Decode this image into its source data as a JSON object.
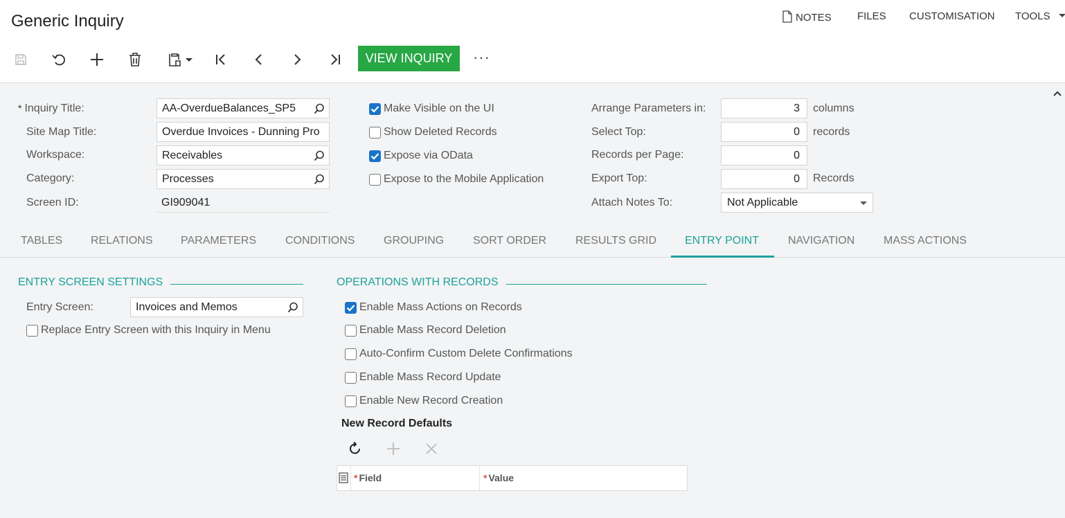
{
  "header": {
    "title": "Generic Inquiry",
    "links": [
      "NOTES",
      "FILES",
      "CUSTOMISATION",
      "TOOLS"
    ]
  },
  "toolbar": {
    "view_inquiry_label": "VIEW INQUIRY",
    "more_label": "···",
    "icons": [
      "save-icon",
      "undo-icon",
      "add-icon",
      "delete-icon",
      "clipboard-icon",
      "first-icon",
      "prev-icon",
      "next-icon",
      "last-icon"
    ]
  },
  "form": {
    "inquiry_title_label": "Inquiry Title:",
    "inquiry_title_value": "AA-OverdueBalances_SP5",
    "site_map_title_label": "Site Map Title:",
    "site_map_title_value": "Overdue Invoices - Dunning Pro",
    "workspace_label": "Workspace:",
    "workspace_value": "Receivables",
    "category_label": "Category:",
    "category_value": "Processes",
    "screen_id_label": "Screen ID:",
    "screen_id_value": "GI909041",
    "required_mark": "*",
    "checkboxes": [
      {
        "label": "Make Visible on the UI",
        "checked": true
      },
      {
        "label": "Show Deleted Records",
        "checked": false
      },
      {
        "label": "Expose via OData",
        "checked": true
      },
      {
        "label": "Expose to the Mobile Application",
        "checked": false
      }
    ],
    "arrange_label": "Arrange Parameters in:",
    "arrange_value": "3",
    "arrange_unit": "columns",
    "select_top_label": "Select Top:",
    "select_top_value": "0",
    "select_top_unit": "records",
    "records_per_page_label": "Records per Page:",
    "records_per_page_value": "0",
    "export_top_label": "Export Top:",
    "export_top_value": "0",
    "export_top_unit": "Records",
    "attach_notes_label": "Attach Notes To:",
    "attach_notes_value": "Not Applicable"
  },
  "tabs": [
    {
      "label": "TABLES",
      "active": false
    },
    {
      "label": "RELATIONS",
      "active": false
    },
    {
      "label": "PARAMETERS",
      "active": false
    },
    {
      "label": "CONDITIONS",
      "active": false
    },
    {
      "label": "GROUPING",
      "active": false
    },
    {
      "label": "SORT ORDER",
      "active": false
    },
    {
      "label": "RESULTS GRID",
      "active": false
    },
    {
      "label": "ENTRY POINT",
      "active": true
    },
    {
      "label": "NAVIGATION",
      "active": false
    },
    {
      "label": "MASS ACTIONS",
      "active": false
    }
  ],
  "entry_point": {
    "entry_section_title": "ENTRY SCREEN SETTINGS",
    "entry_screen_label": "Entry Screen:",
    "entry_screen_value": "Invoices and Memos",
    "replace_label": "Replace Entry Screen with this Inquiry in Menu",
    "replace_checked": false,
    "ops_section_title": "OPERATIONS WITH RECORDS",
    "ops": [
      {
        "label": "Enable Mass Actions on Records",
        "checked": true
      },
      {
        "label": "Enable Mass Record Deletion",
        "checked": false
      },
      {
        "label": "Auto-Confirm Custom Delete Confirmations",
        "checked": false
      },
      {
        "label": "Enable Mass Record Update",
        "checked": false
      },
      {
        "label": "Enable New Record Creation",
        "checked": false
      }
    ],
    "defaults_title": "New Record Defaults",
    "grid_columns": [
      "Field",
      "Value"
    ]
  },
  "colors": {
    "accent": "#1aa29b",
    "primary_button": "#28a745",
    "checkbox": "#1a73c8"
  }
}
